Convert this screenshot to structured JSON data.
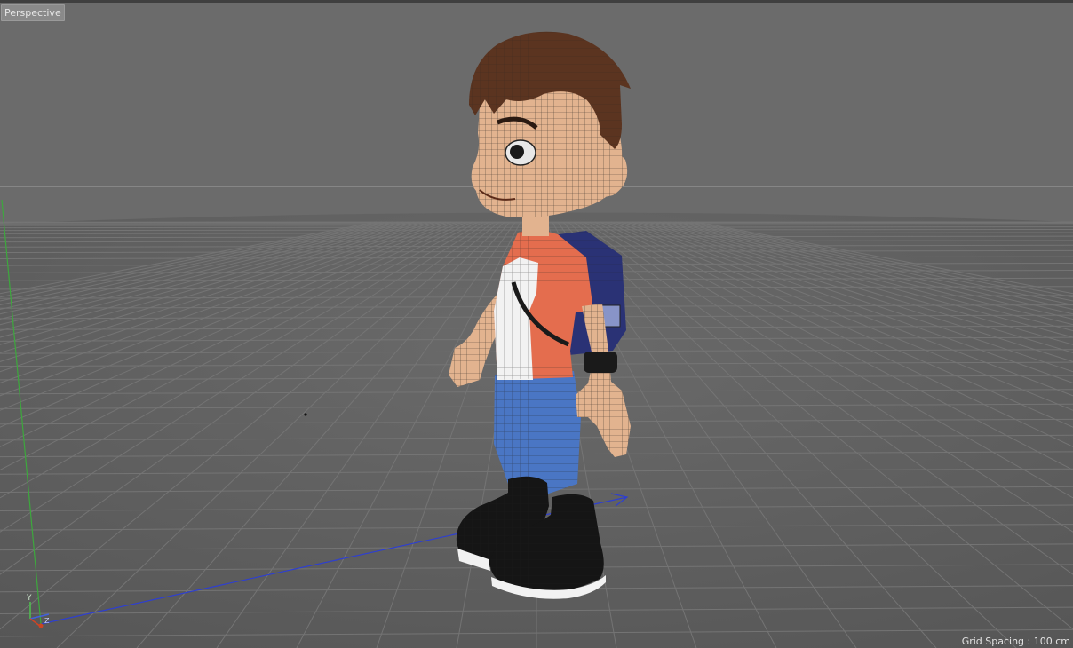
{
  "viewport": {
    "label": "Perspective",
    "grid_spacing": "Grid Spacing : 100 cm",
    "axis_labels": {
      "y": "Y",
      "z": "Z"
    }
  },
  "colors": {
    "sky": "#6b6b6b",
    "floor": "#5b5b5b",
    "grid_line": "#777777",
    "horizon_line": "#9a9a9a",
    "axis_x": "#2e3fd0",
    "axis_y": "#3da83d",
    "axis_z_marker": "#cc4422",
    "skin": "#e2b38f",
    "hair": "#5b3420",
    "shirt_red": "#e46d4e",
    "shirt_white": "#f2f2f2",
    "pants": "#4a76c4",
    "backpack": "#2a3275",
    "shoes": "#151515",
    "shoe_sole": "#f2f2f2",
    "wire": "#222222"
  },
  "icons": [
    "axis-gizmo-icon",
    "character-model"
  ]
}
